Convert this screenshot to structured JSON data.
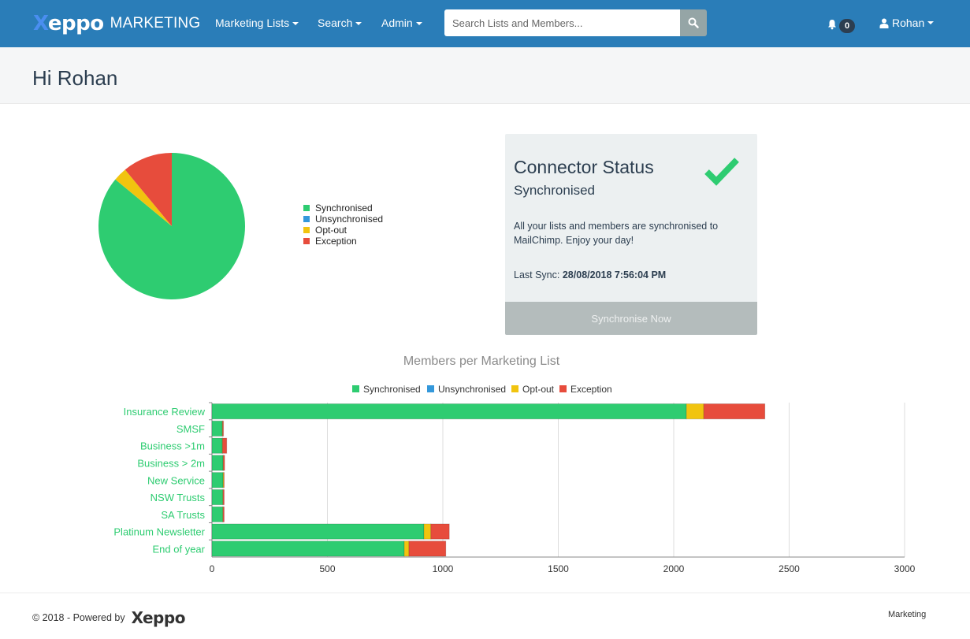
{
  "navbar": {
    "brand_logo": "Xeppo",
    "brand_text": "MARKETING",
    "menu": [
      {
        "label": "Marketing Lists"
      },
      {
        "label": "Search"
      },
      {
        "label": "Admin"
      }
    ],
    "search_placeholder": "Search Lists and Members...",
    "search_icon": "search-icon",
    "notifications_count": "0",
    "notifications_icon": "bell-icon",
    "user_name": "Rohan",
    "user_icon": "user-icon"
  },
  "header": {
    "greeting": "Hi Rohan"
  },
  "colors": {
    "synchronised": "#2ecc71",
    "unsynchronised": "#3498db",
    "opt_out": "#f1c40f",
    "exception": "#e74c3c",
    "navbar": "#2a7db8"
  },
  "connector": {
    "title": "Connector Status",
    "status": "Synchronised",
    "status_icon": "checkmark-icon",
    "message": "All your lists and members are synchronised to MailChimp. Enjoy your day!",
    "last_sync_label": "Last Sync:",
    "last_sync_value": "28/08/2018 7:56:04 PM",
    "button_label": "Synchronise Now"
  },
  "chart_data": [
    {
      "type": "pie",
      "title": "",
      "legend_position": "right",
      "labels": [
        "Synchronised",
        "Unsynchronised",
        "Opt-out",
        "Exception"
      ],
      "values": [
        86,
        0,
        3,
        11
      ],
      "units": "percent"
    },
    {
      "type": "bar",
      "orientation": "horizontal",
      "stacked": true,
      "title": "Members per Marketing List",
      "legend_position": "top",
      "categories": [
        "Insurance Review",
        "SMSF",
        "Business >1m",
        "Business > 2m",
        "New Service",
        "NSW Trusts",
        "SA Trusts",
        "Platinum Newsletter",
        "End of year"
      ],
      "series": [
        {
          "name": "Synchronised",
          "values": [
            2055,
            45,
            45,
            48,
            48,
            47,
            47,
            918,
            833
          ]
        },
        {
          "name": "Unsynchronised",
          "values": [
            0,
            0,
            0,
            0,
            0,
            0,
            0,
            0,
            0
          ]
        },
        {
          "name": "Opt-out",
          "values": [
            75,
            1,
            1,
            1,
            3,
            1,
            1,
            30,
            20
          ]
        },
        {
          "name": "Exception",
          "values": [
            265,
            4,
            18,
            6,
            2,
            5,
            5,
            80,
            160
          ]
        }
      ],
      "xlim": [
        0,
        3000
      ],
      "xticks": [
        "0",
        "500",
        "1000",
        "1500",
        "2000",
        "2500",
        "3000"
      ],
      "grid": true
    }
  ],
  "footer": {
    "copyright": "© 2018 - Powered by",
    "logo": "Xeppo",
    "right_text": "Marketing"
  }
}
